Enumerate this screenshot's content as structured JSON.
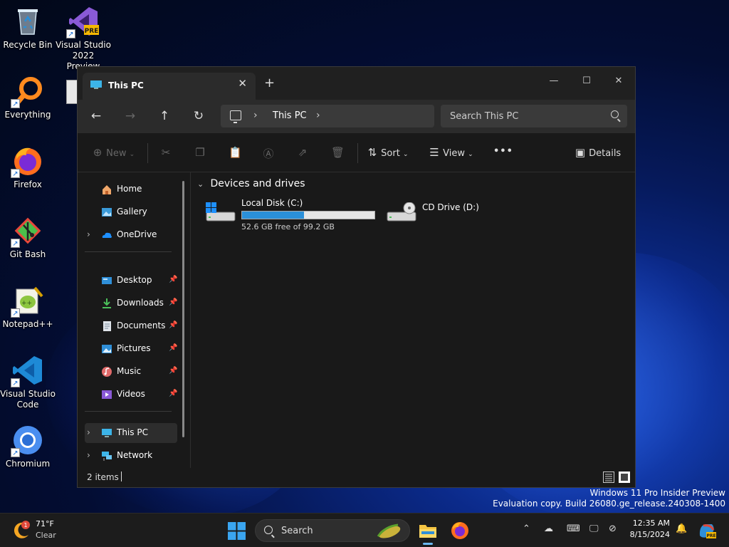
{
  "desktop": {
    "icons": [
      {
        "label": "Recycle Bin"
      },
      {
        "label": "Visual Studio 2022 Preview",
        "badge": "PRE"
      },
      {
        "label": "Everything"
      },
      {
        "label": "Firefox"
      },
      {
        "label": "Git Bash"
      },
      {
        "label": "Notepad++"
      },
      {
        "label": "Visual Studio Code"
      },
      {
        "label": "Chromium"
      }
    ]
  },
  "explorer": {
    "tab_title": "This PC",
    "breadcrumb": "This PC",
    "search_placeholder": "Search This PC",
    "commands": {
      "new": "New",
      "sort": "Sort",
      "view": "View",
      "details": "Details"
    },
    "sidebar": {
      "top": [
        {
          "label": "Home"
        },
        {
          "label": "Gallery"
        },
        {
          "label": "OneDrive"
        }
      ],
      "quick": [
        {
          "label": "Desktop"
        },
        {
          "label": "Downloads"
        },
        {
          "label": "Documents"
        },
        {
          "label": "Pictures"
        },
        {
          "label": "Music"
        },
        {
          "label": "Videos"
        }
      ],
      "bottom": [
        {
          "label": "This PC"
        },
        {
          "label": "Network"
        }
      ]
    },
    "group_header": "Devices and drives",
    "drives": [
      {
        "name": "Local Disk (C:)",
        "free_text": "52.6 GB free of 99.2 GB",
        "used_fraction": 0.47
      },
      {
        "name": "CD Drive (D:)"
      }
    ],
    "status": {
      "item_count": "2 items"
    }
  },
  "watermark": {
    "line1": "Windows 11 Pro Insider Preview",
    "line2": "Evaluation copy. Build 26080.ge_release.240308-1400"
  },
  "taskbar": {
    "weather_temp": "71°F",
    "weather_desc": "Clear",
    "weather_badge": "1",
    "search_label": "Search",
    "time": "12:35 AM",
    "date": "8/15/2024",
    "copilot_badge": "PRE"
  },
  "colors": {
    "accent": "#2b90d9",
    "window_bg": "#191919",
    "titlebar_bg": "#202020",
    "taskbar_bg": "#1c1c1c"
  }
}
